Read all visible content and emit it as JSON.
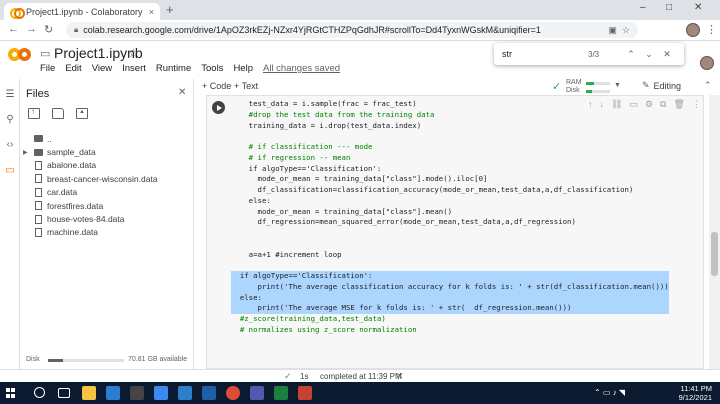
{
  "browser": {
    "tab_title": "Project1.ipynb - Colaboratory",
    "tab_close": "×",
    "new_tab": "+",
    "url": "colab.research.google.com/drive/1ApOZ3rkEZj-NZxr4YjRGtCTHZPqGdhJR#scrollTo=Dd4TyxnWGskM&uniqifier=1",
    "minimize": "–",
    "maximize": "□",
    "close": "✕"
  },
  "notebook": {
    "title": "Project1.ipynb",
    "menu": [
      "File",
      "Edit",
      "View",
      "Insert",
      "Runtime",
      "Tools",
      "Help"
    ],
    "saved_status": "All changes saved"
  },
  "find": {
    "query": "str",
    "count": "3/3"
  },
  "toolbar": {
    "code_label": "+ Code",
    "text_label": "+ Text",
    "ram_label": "RAM",
    "disk_label": "Disk",
    "ram_fraction": 0.35,
    "disk_fraction": 0.25,
    "editing_label": "Editing"
  },
  "files": {
    "title": "Files",
    "items": [
      {
        "name": "..",
        "type": "folder",
        "arrow": false
      },
      {
        "name": "sample_data",
        "type": "folder",
        "arrow": true
      },
      {
        "name": "abalone.data",
        "type": "file",
        "arrow": false
      },
      {
        "name": "breast-cancer-wisconsin.data",
        "type": "file",
        "arrow": false
      },
      {
        "name": "car.data",
        "type": "file",
        "arrow": false
      },
      {
        "name": "forestfires.data",
        "type": "file",
        "arrow": false
      },
      {
        "name": "house-votes-84.data",
        "type": "file",
        "arrow": false
      },
      {
        "name": "machine.data",
        "type": "file",
        "arrow": false
      }
    ],
    "disk_label": "Disk",
    "disk_free": "70.81 GB available",
    "disk_used_fraction": 0.2
  },
  "code_lines": [
    {
      "text": "    test_data = i.sample(frac = frac_test)",
      "cls": "",
      "sel": false
    },
    {
      "text": "    #drop the test data from the training data",
      "cls": "cm",
      "sel": false
    },
    {
      "text": "    training_data = i.drop(test_data.index)",
      "cls": "",
      "sel": false
    },
    {
      "text": "",
      "cls": "",
      "sel": false
    },
    {
      "text": "    # if classification --- mode",
      "cls": "cm",
      "sel": false
    },
    {
      "text": "    # if regression -- mean",
      "cls": "cm",
      "sel": false
    },
    {
      "text": "    if algoType=='Classification':",
      "cls": "",
      "sel": false
    },
    {
      "text": "      mode_or_mean = training_data[\"class\"].mode().iloc[0]",
      "cls": "",
      "sel": false
    },
    {
      "text": "      df_classification=classification_accuracy(mode_or_mean,test_data,a,df_classification)",
      "cls": "",
      "sel": false
    },
    {
      "text": "    else:",
      "cls": "",
      "sel": false
    },
    {
      "text": "      mode_or_mean = training_data[\"class\"].mean()",
      "cls": "",
      "sel": false
    },
    {
      "text": "      df_regression=mean_squared_error(mode_or_mean,test_data,a,df_regression)",
      "cls": "",
      "sel": false
    },
    {
      "text": "",
      "cls": "",
      "sel": false
    },
    {
      "text": "",
      "cls": "",
      "sel": false
    },
    {
      "text": "    a=a+1 #increment loop",
      "cls": "",
      "sel": false
    },
    {
      "text": "",
      "cls": "",
      "sel": false
    },
    {
      "text": "  if algoType=='Classification':",
      "cls": "",
      "sel": true
    },
    {
      "text": "      print('The average classification accuracy for k folds is: ' + str(df_classification.mean()))",
      "cls": "",
      "sel": true
    },
    {
      "text": "  else:",
      "cls": "",
      "sel": true
    },
    {
      "text": "      print('The average MSE for k folds is: ' + str(  df_regression.mean()))",
      "cls": "",
      "sel": true
    },
    {
      "text": "  #z_score(training_data,test_data)",
      "cls": "cm",
      "sel": false
    },
    {
      "text": "  # normalizes using z_score normalization",
      "cls": "cm",
      "sel": false
    }
  ],
  "status": {
    "duration": "1s",
    "completed": "completed at 11:39 PM",
    "close": "✕"
  },
  "taskbar": {
    "time": "11:41 PM",
    "date": "9/12/2021"
  }
}
